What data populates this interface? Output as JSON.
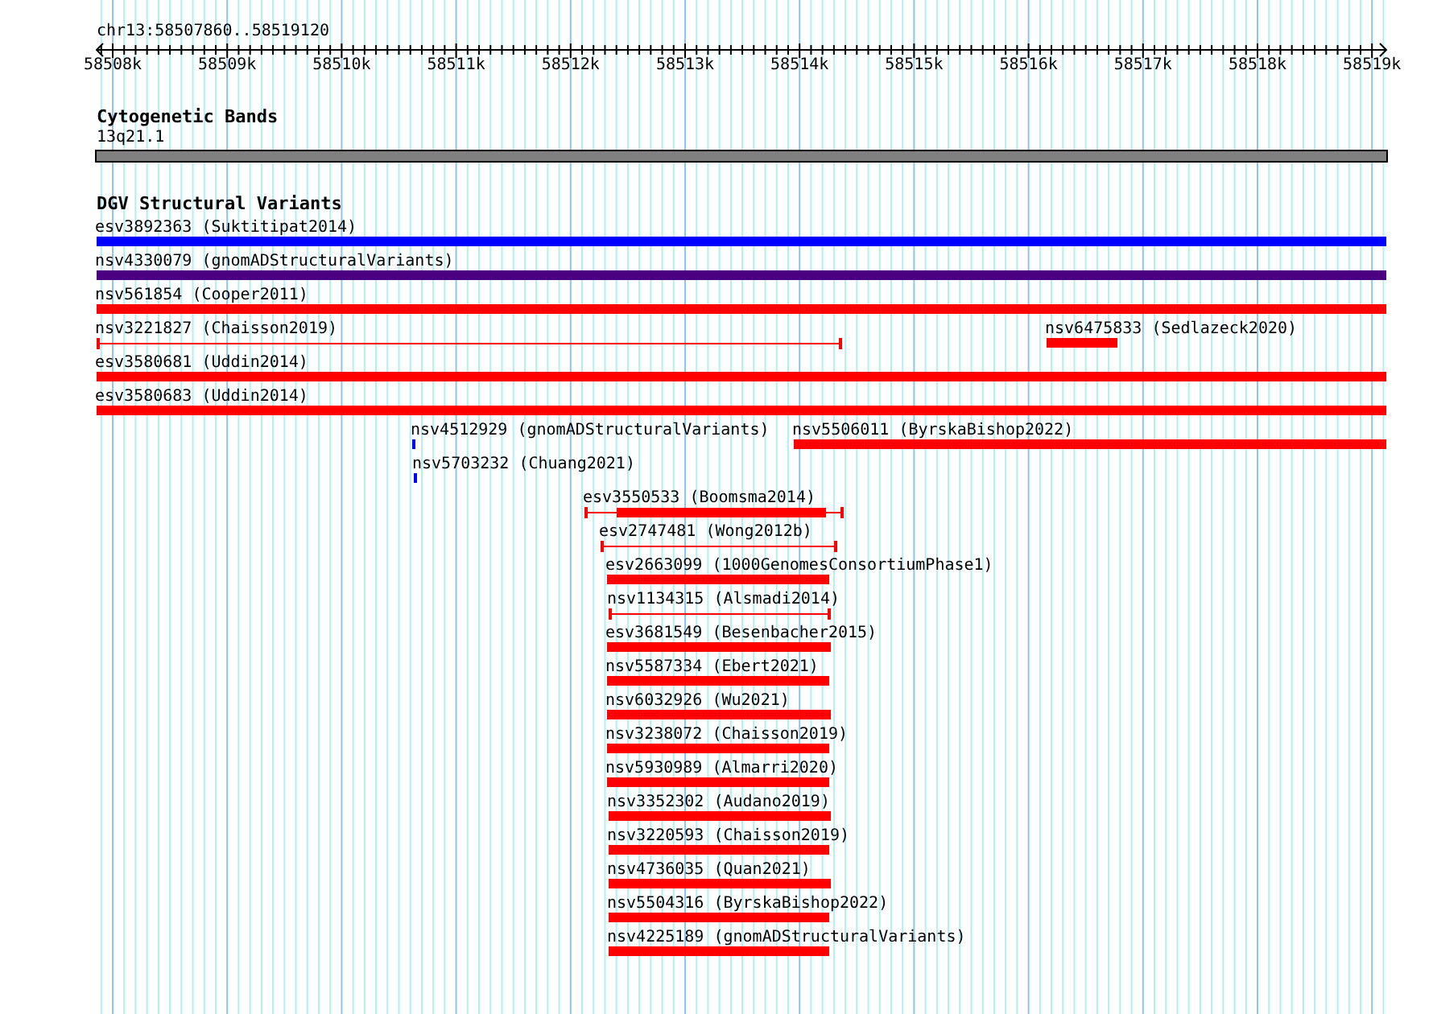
{
  "ruler": {
    "location": "chr13:58507860..58519120",
    "labels": [
      "58508k",
      "58509k",
      "58510k",
      "58511k",
      "58512k",
      "58513k",
      "58514k",
      "58515k",
      "58516k",
      "58517k",
      "58518k",
      "58519k"
    ]
  },
  "cytogenetic_bands": {
    "title": "Cytogenetic Bands",
    "band_label": "13q21.1"
  },
  "structural_variants": {
    "title": "DGV Structural Variants",
    "features": [
      {
        "label": "esv3892363 (Suktitipat2014)",
        "kind": "bar",
        "color": "#0000ff"
      },
      {
        "label": "nsv4330079 (gnomADStructuralVariants)",
        "kind": "bar",
        "color": "#4b0082"
      },
      {
        "label": "nsv561854 (Cooper2011)",
        "kind": "bar",
        "color": "#ff0000"
      },
      {
        "label": "nsv3221827 (Chaisson2019)",
        "kind": "line",
        "color": "#ff0000"
      },
      {
        "label": "nsv6475833 (Sedlazeck2020)",
        "kind": "bar",
        "color": "#ff0000"
      },
      {
        "label": "esv3580681 (Uddin2014)",
        "kind": "bar",
        "color": "#ff0000"
      },
      {
        "label": "esv3580683 (Uddin2014)",
        "kind": "bar",
        "color": "#ff0000"
      },
      {
        "label": "nsv4512929 (gnomADStructuralVariants)",
        "kind": "bar",
        "color": "#0000ff"
      },
      {
        "label": "nsv5506011 (ByrskaBishop2022)",
        "kind": "bar",
        "color": "#ff0000"
      },
      {
        "label": "nsv5703232 (Chuang2021)",
        "kind": "bar",
        "color": "#0000ff"
      },
      {
        "label": "esv3550533 (Boomsma2014)",
        "kind": "line_with_bar",
        "color": "#ff0000"
      },
      {
        "label": "esv2747481 (Wong2012b)",
        "kind": "line",
        "color": "#ff0000"
      },
      {
        "label": "esv2663099 (1000GenomesConsortiumPhase1)",
        "kind": "bar",
        "color": "#ff0000"
      },
      {
        "label": "nsv1134315 (Alsmadi2014)",
        "kind": "line",
        "color": "#ff0000"
      },
      {
        "label": "esv3681549 (Besenbacher2015)",
        "kind": "bar",
        "color": "#ff0000"
      },
      {
        "label": "nsv5587334 (Ebert2021)",
        "kind": "bar",
        "color": "#ff0000"
      },
      {
        "label": "nsv6032926 (Wu2021)",
        "kind": "bar",
        "color": "#ff0000"
      },
      {
        "label": "nsv3238072 (Chaisson2019)",
        "kind": "bar",
        "color": "#ff0000"
      },
      {
        "label": "nsv5930989 (Almarri2020)",
        "kind": "bar",
        "color": "#ff0000"
      },
      {
        "label": "nsv3352302 (Audano2019)",
        "kind": "bar",
        "color": "#ff0000"
      },
      {
        "label": "nsv3220593 (Chaisson2019)",
        "kind": "bar",
        "color": "#ff0000"
      },
      {
        "label": "nsv4736035 (Quan2021)",
        "kind": "bar",
        "color": "#ff0000"
      },
      {
        "label": "nsv5504316 (ByrskaBishop2022)",
        "kind": "bar",
        "color": "#ff0000"
      },
      {
        "label": "nsv4225189 (gnomADStructuralVariants)",
        "kind": "bar",
        "color": "#ff0000"
      }
    ]
  }
}
